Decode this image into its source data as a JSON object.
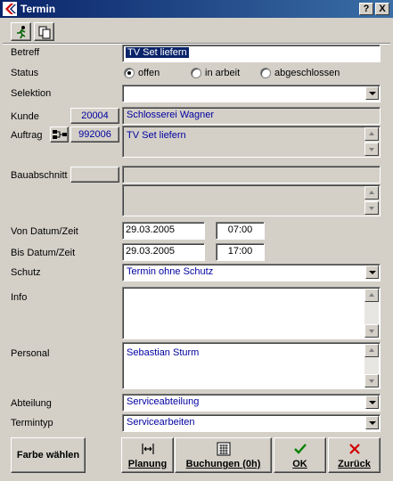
{
  "window": {
    "title": "Termin",
    "help_label": "?",
    "close_label": "X"
  },
  "labels": {
    "betreff": "Betreff",
    "status": "Status",
    "selektion": "Selektion",
    "kunde": "Kunde",
    "auftrag": "Auftrag",
    "bauabschnitt": "Bauabschnitt",
    "von": "Von Datum/Zeit",
    "bis": "Bis Datum/Zeit",
    "schutz": "Schutz",
    "info": "Info",
    "personal": "Personal",
    "abteilung": "Abteilung",
    "termintyp": "Termintyp"
  },
  "fields": {
    "betreff": "TV Set liefern",
    "selektion": "",
    "kunde_nr": "20004",
    "kunde_name": "Schlosserei Wagner",
    "auftrag_nr": "992006",
    "auftrag_text": "TV Set liefern",
    "bauabschnitt_nr": "",
    "bauabschnitt_name": "",
    "bauabschnitt_text": "",
    "von_datum": "29.03.2005",
    "von_zeit": "07:00",
    "bis_datum": "29.03.2005",
    "bis_zeit": "17:00",
    "schutz": "Termin ohne Schutz",
    "info": "",
    "personal": "Sebastian Sturm",
    "abteilung": "Serviceabteilung",
    "termintyp": "Servicearbeiten"
  },
  "status_options": [
    {
      "label": "offen",
      "checked": true
    },
    {
      "label": "in arbeit",
      "checked": false
    },
    {
      "label": "abgeschlossen",
      "checked": false
    }
  ],
  "buttons": {
    "farbe": "Farbe wählen",
    "planung": "Planung",
    "buchungen": "Buchungen (0h)",
    "ok": "OK",
    "zurueck": "Zurück"
  },
  "colors": {
    "title_bar": "#0a246a",
    "value_text": "#0000a0",
    "ok_icon": "#008000",
    "cancel_icon": "#d00000"
  }
}
